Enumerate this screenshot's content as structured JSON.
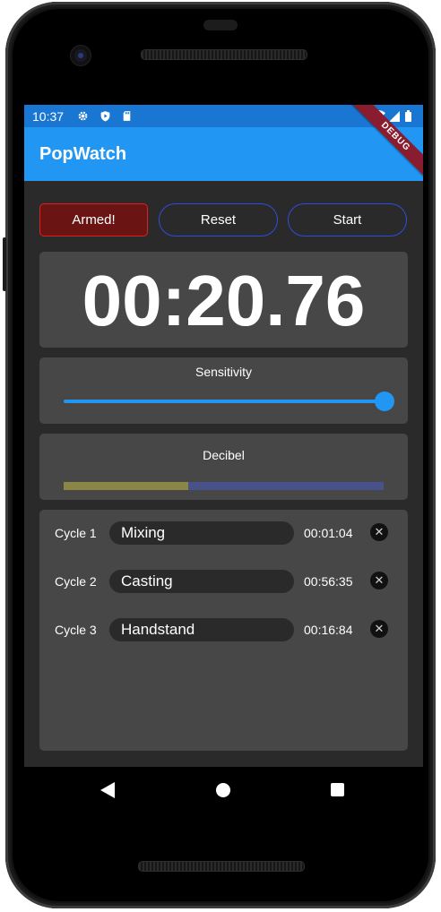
{
  "status_bar": {
    "time": "10:37",
    "icons": [
      "settings-icon",
      "shield-icon",
      "sd-card-icon",
      "wifi-icon",
      "signal-icon",
      "battery-icon"
    ]
  },
  "app_bar": {
    "title": "PopWatch"
  },
  "debug_banner": "DEBUG",
  "controls": {
    "armed_label": "Armed!",
    "reset_label": "Reset",
    "start_label": "Start"
  },
  "timer": {
    "display": "00:20.76"
  },
  "sensitivity": {
    "label": "Sensitivity",
    "value": 1.0
  },
  "decibel": {
    "label": "Decibel",
    "level": 0.39
  },
  "cycles": [
    {
      "label": "Cycle 1",
      "name": "Mixing",
      "time": "00:01:04"
    },
    {
      "label": "Cycle 2",
      "name": "Casting",
      "time": "00:56:35"
    },
    {
      "label": "Cycle 3",
      "name": "Handstand",
      "time": "00:16:84"
    }
  ],
  "colors": {
    "primary": "#2196f3",
    "status_bar": "#1976d2",
    "armed_bg": "#6a1414",
    "armed_border": "#e02020",
    "outline_button": "#2c4ee0",
    "card": "#474747",
    "background": "#2a2a2a",
    "decibel_fill": "#8c8646",
    "decibel_track": "#47518a"
  }
}
